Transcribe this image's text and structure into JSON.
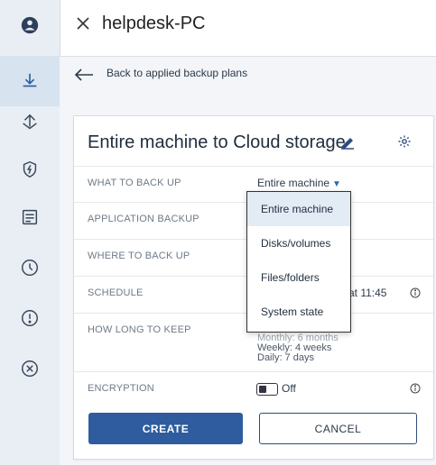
{
  "header": {
    "title": "helpdesk-PC"
  },
  "back": {
    "label": "Back to applied backup plans"
  },
  "plan": {
    "title": "Entire machine to Cloud storage",
    "rows": [
      {
        "label": "WHAT TO BACK UP",
        "value": "Entire machine"
      },
      {
        "label": "APPLICATION BACKUP",
        "value": ""
      },
      {
        "label": "WHERE TO BACK UP",
        "value": ""
      },
      {
        "label": "SCHEDULE",
        "value": "at 11:45"
      },
      {
        "label": "HOW LONG TO KEEP",
        "value": "Monthly: 6 months\nWeekly: 4 weeks\nDaily: 7 days"
      },
      {
        "label": "ENCRYPTION",
        "value": "Off"
      }
    ],
    "keep": {
      "monthly": "Monthly: 6 months",
      "weekly": "Weekly: 4 weeks",
      "daily": "Daily: 7 days"
    },
    "encryption_state": "Off"
  },
  "buttons": {
    "create": "CREATE",
    "cancel": "CANCEL"
  },
  "dropdown": {
    "options": [
      "Entire machine",
      "Disks/volumes",
      "Files/folders",
      "System state"
    ],
    "selected": "Entire machine"
  },
  "sidebar": {
    "items": [
      "account-icon",
      "backup-icon",
      "anchor-icon",
      "shield-icon",
      "report-icon",
      "clock-icon",
      "alert-icon",
      "cancel-circle-icon"
    ],
    "active": "backup-icon"
  },
  "colors": {
    "primary": "#2e5c9e",
    "sidebar_bg": "#e9eef5",
    "accent": "#2b6cb0"
  }
}
